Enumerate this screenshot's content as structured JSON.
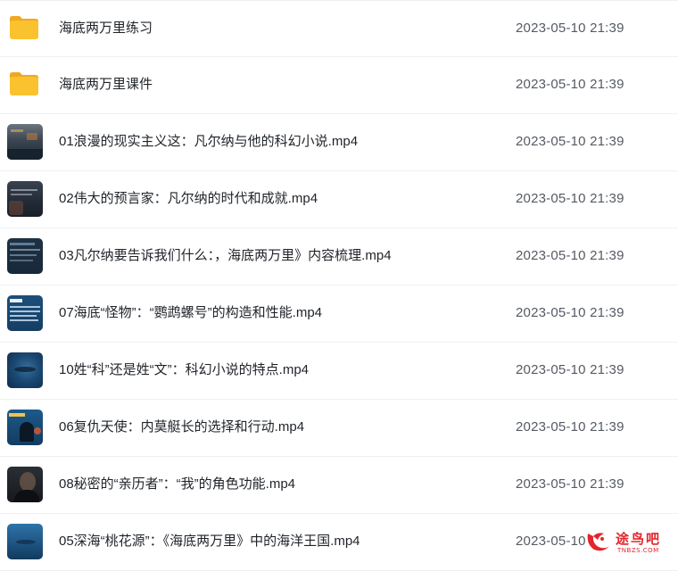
{
  "files": [
    {
      "name": "海底两万里练习",
      "date": "2023-05-10 21:39",
      "type": "folder"
    },
    {
      "name": "海底两万里课件",
      "date": "2023-05-10 21:39",
      "type": "folder"
    },
    {
      "name": "01浪漫的现实主义这：凡尔纳与他的科幻小说.mp4",
      "date": "2023-05-10 21:39",
      "type": "video"
    },
    {
      "name": "02伟大的预言家：凡尔纳的时代和成就.mp4",
      "date": "2023-05-10 21:39",
      "type": "video"
    },
    {
      "name": "03凡尔纳要告诉我们什么：，海底两万里》内容梳理.mp4",
      "date": "2023-05-10 21:39",
      "type": "video"
    },
    {
      "name": "07海底“怪物”：“鹦鹉螺号”的构造和性能.mp4",
      "date": "2023-05-10 21:39",
      "type": "video"
    },
    {
      "name": "10姓“科”还是姓“文”：科幻小说的特点.mp4",
      "date": "2023-05-10 21:39",
      "type": "video"
    },
    {
      "name": "06复仇天使：内莫艇长的选择和行动.mp4",
      "date": "2023-05-10 21:39",
      "type": "video"
    },
    {
      "name": "08秘密的“亲历者”：“我”的角色功能.mp4",
      "date": "2023-05-10 21:39",
      "type": "video"
    },
    {
      "name": "05深海“桃花源”：《海底两万里》中的海洋王国.mp4",
      "date": "2023-05-10 21:39",
      "type": "video"
    }
  ],
  "watermark": {
    "text": "途鸟吧",
    "sub": "TNBZS.COM"
  },
  "colors": {
    "folder": "#f9c22e",
    "folder_tab": "#f1a81f",
    "text": "#1f2329",
    "date": "#555a63",
    "watermark": "#e2262b"
  }
}
